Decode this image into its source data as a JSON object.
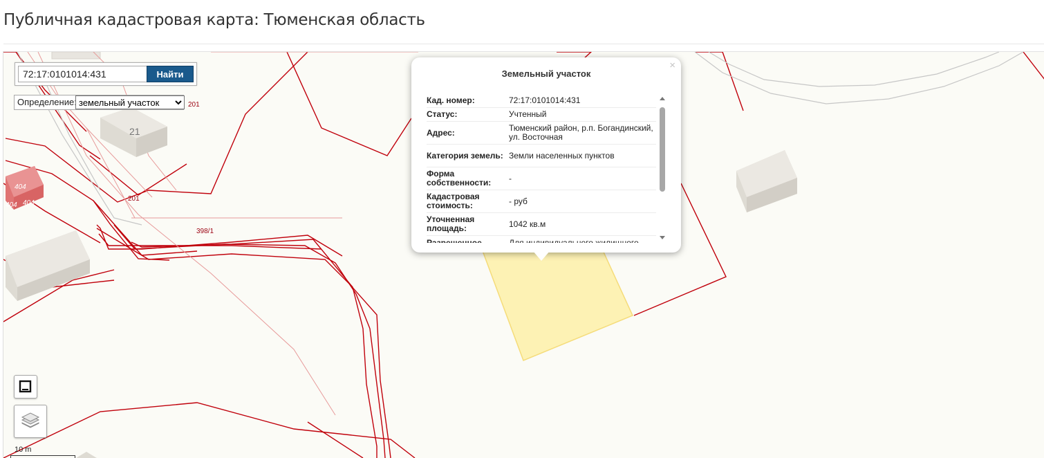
{
  "page": {
    "title": "Публичная кадастровая карта: Тюменская область"
  },
  "search": {
    "value": "72:17:0101014:431",
    "button_label": "Найти"
  },
  "definition": {
    "label": "Определение:",
    "selected": "земельный участок"
  },
  "map_labels": {
    "building_21": "21",
    "parcel_201_top": "201",
    "parcel_201_mid": "201",
    "parcel_398_1": "398/1",
    "building_404_a": "404",
    "building_404_b": "404",
    "building_404_c": "404"
  },
  "scale": {
    "label": "10 m"
  },
  "popup": {
    "title": "Земельный участок",
    "close": "×",
    "rows": [
      {
        "key": "Кад. номер:",
        "value": "72:17:0101014:431"
      },
      {
        "key": "Статус:",
        "value": "Учтенный"
      },
      {
        "key": "Адрес:",
        "value": "Тюменский район, р.п. Богандинский, ул. Восточная"
      },
      {
        "key": "Категория земель:",
        "value": "Земли населенных пунктов"
      },
      {
        "key": "Форма собственности:",
        "value": "-"
      },
      {
        "key": "Кадастровая стоимость:",
        "value": "- руб"
      },
      {
        "key": "Уточненная площадь:",
        "value": "1042 кв.м"
      },
      {
        "key": "Разрешенное",
        "value": "Для индивидуального жилищного"
      }
    ]
  },
  "colors": {
    "parcel_line": "#c0000b",
    "selected_fill": "#fdf2b4",
    "building_red": "#e07474",
    "search_button": "#1a5a8c"
  },
  "icons": {
    "measure": "measure-icon",
    "layers": "layers-icon"
  }
}
